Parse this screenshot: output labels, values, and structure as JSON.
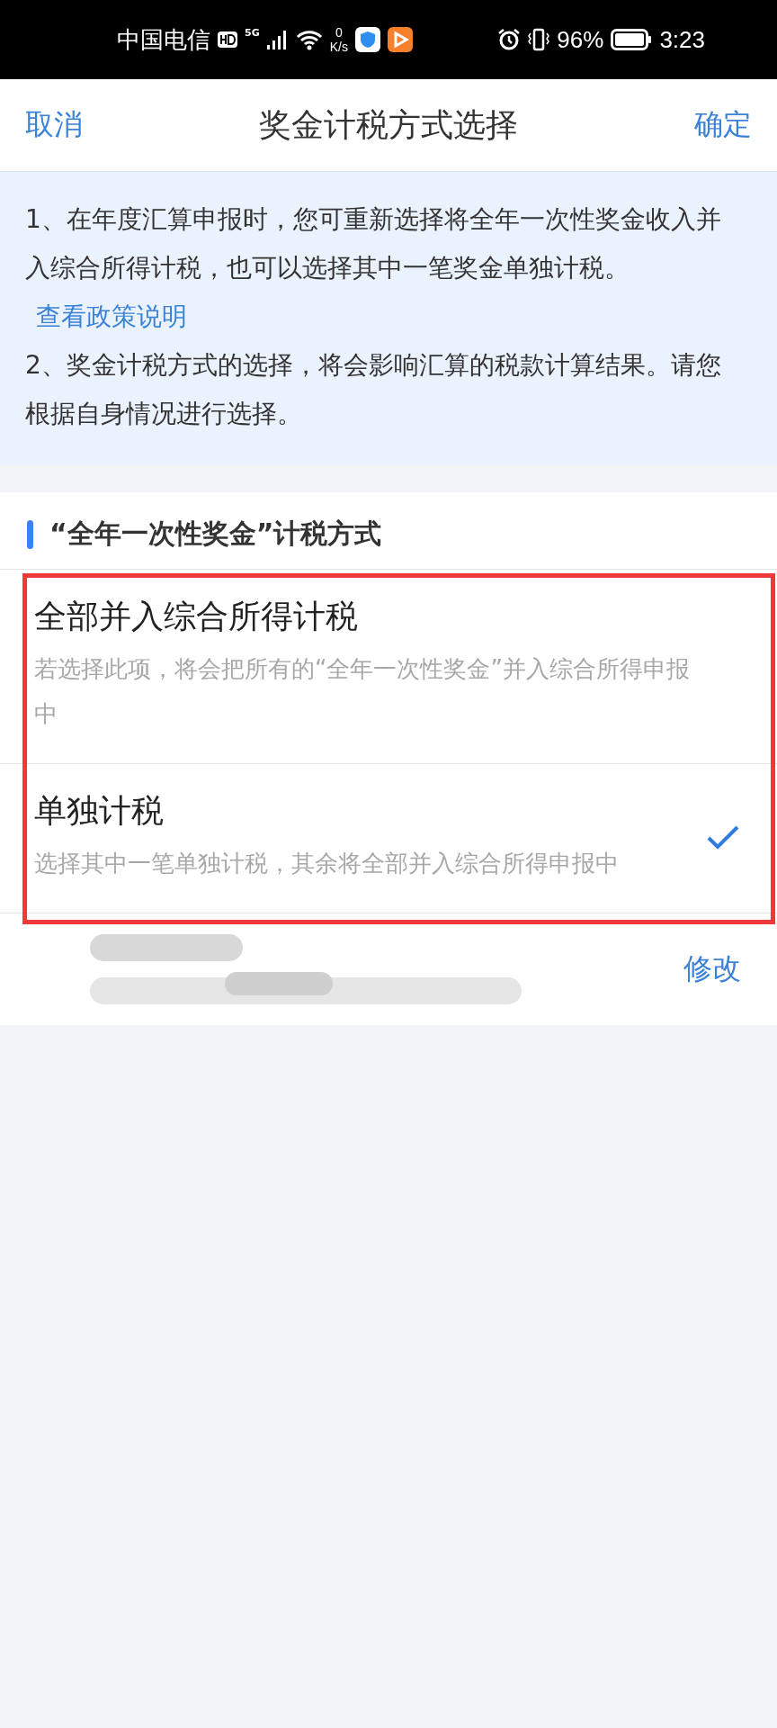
{
  "status_bar": {
    "carrier": "中国电信",
    "network": "5G",
    "speed_value": "0",
    "speed_unit": "K/s",
    "battery": "96%",
    "time": "3:23"
  },
  "nav": {
    "cancel": "取消",
    "title": "奖金计税方式选择",
    "confirm": "确定"
  },
  "notice": {
    "line_1": "1、在年度汇算申报时，您可重新选择将全年一次性奖金收入并入综合所得计税，也可以选择其中一笔奖金单独计税。",
    "policy_link": "查看政策说明",
    "line_2": "2、奖金计税方式的选择，将会影响汇算的税款计算结果。请您根据自身情况进行选择。"
  },
  "section": {
    "title": "“全年一次性奖金”计税方式"
  },
  "options": [
    {
      "title": "全部并入综合所得计税",
      "description": "若选择此项，将会把所有的“全年一次性奖金”并入综合所得申报中",
      "selected": false
    },
    {
      "title": "单独计税",
      "description": "选择其中一笔单独计税，其余将全部并入综合所得申报中",
      "selected": true
    }
  ],
  "bonus_row": {
    "edit": "修改"
  }
}
